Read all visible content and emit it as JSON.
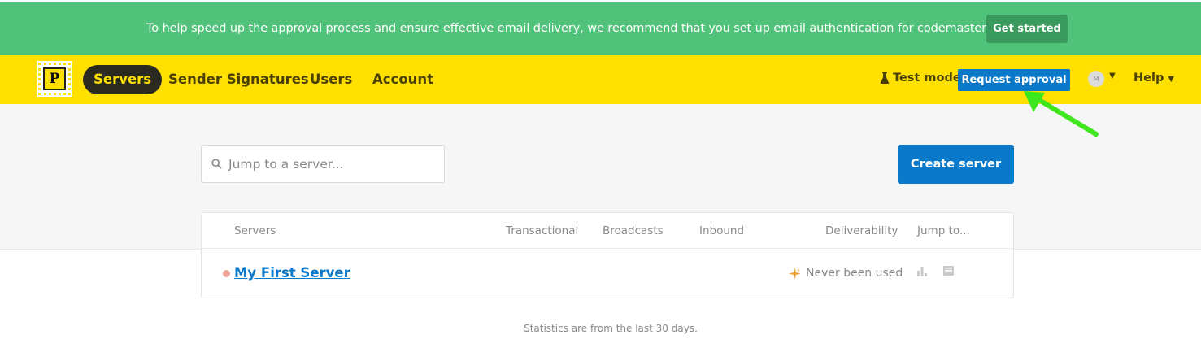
{
  "banner": {
    "message": "To help speed up the approval process and ensure effective email delivery, we recommend that you set up email authentication for codemasterhub.com.",
    "cta_label": "Get started"
  },
  "nav": {
    "logo_letter": "P",
    "items": [
      {
        "label": "Servers",
        "active": true
      },
      {
        "label": "Sender Signatures"
      },
      {
        "label": "Users"
      },
      {
        "label": "Account"
      }
    ],
    "test_mode_label": "Test mode",
    "request_approval_label": "Request approval",
    "avatar_initial": "M",
    "help_label": "Help"
  },
  "search": {
    "placeholder": "Jump to a server..."
  },
  "create_server_label": "Create server",
  "table": {
    "columns": [
      "Servers",
      "Transactional",
      "Broadcasts",
      "Inbound",
      "Deliverability",
      "Jump to..."
    ],
    "rows": [
      {
        "name": "My First Server",
        "status_text": "Never been used"
      }
    ]
  },
  "footnote": "Statistics are from the last 30 days.",
  "colors": {
    "banner_green": "#51c27a",
    "nav_yellow": "#ffe000",
    "primary_blue": "#0a79c9",
    "annotation_arrow": "#3ee61e"
  }
}
